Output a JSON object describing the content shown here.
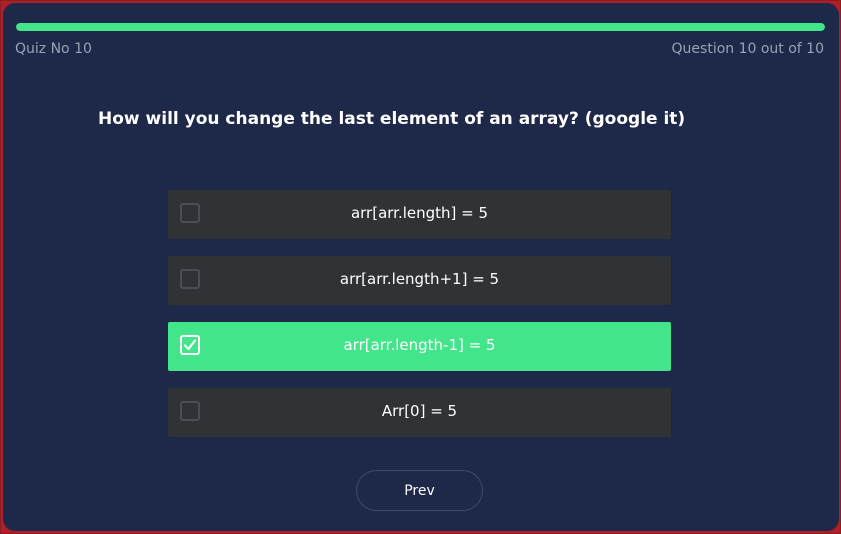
{
  "header": {
    "quiz_label": "Quiz No 10",
    "question_count": "Question 10 out of 10",
    "progress": 1.0
  },
  "question": {
    "text": "How will you change the last element of an array? (google it)"
  },
  "options": [
    {
      "label": "arr[arr.length] = 5",
      "selected": false
    },
    {
      "label": "arr[arr.length+1] = 5",
      "selected": false
    },
    {
      "label": "arr[arr.length-1] = 5",
      "selected": true
    },
    {
      "label": "Arr[0] = 5",
      "selected": false
    }
  ],
  "footer": {
    "prev_label": "Prev"
  },
  "colors": {
    "accent": "#43e58b",
    "card_background": "#1e2848",
    "option_background": "#2f3336",
    "border": "#b01e28"
  },
  "icons": {
    "checkmark": "check-icon"
  }
}
